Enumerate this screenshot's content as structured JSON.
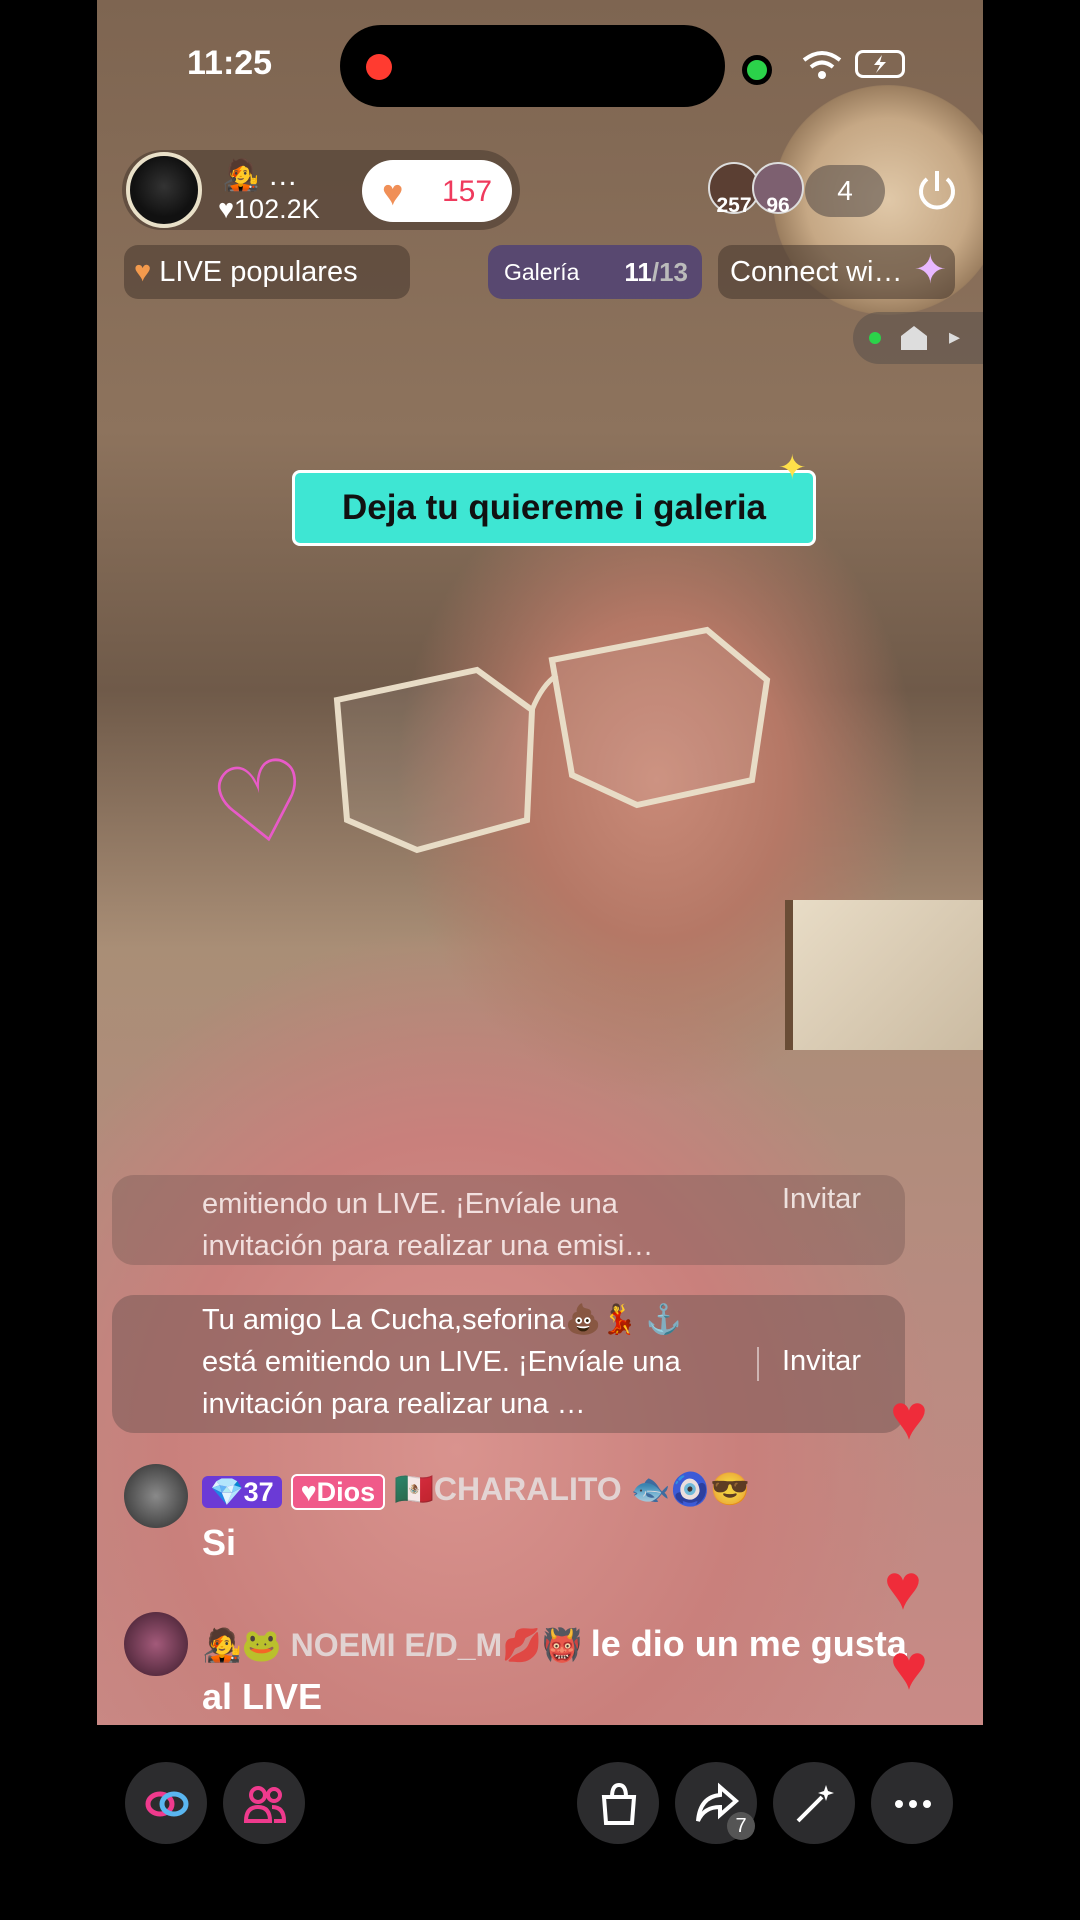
{
  "status": {
    "time": "11:25"
  },
  "host": {
    "name": "…",
    "likes": "102.2K",
    "like_count": "157"
  },
  "viewers": {
    "badge1": "257",
    "badge2": "96",
    "count": "4"
  },
  "tags": {
    "live_popular": "LIVE populares",
    "gallery_label": "Galería",
    "gallery_current": "11",
    "gallery_total": "/13",
    "connect": "Connect wi…"
  },
  "sticker": {
    "text": "Deja tu quiereme i galeria"
  },
  "invites": [
    {
      "text": "emitiendo un LIVE. ¡Envíale una invitación para realizar una emisi…",
      "button": "Invitar"
    },
    {
      "text": "Tu amigo La Cucha,seforina💩💃 ⚓ está emitiendo un LIVE. ¡Envíale una invitación para realizar una …",
      "button": "Invitar"
    }
  ],
  "comments": [
    {
      "level": "37",
      "fan_badge": "Dios",
      "name": "🇲🇽CHARALITO 🐟🧿😎",
      "text": "Si"
    },
    {
      "name": "🐸 NOEMI E/D_M💋👹",
      "text": "le dio un me gusta al LIVE"
    }
  ],
  "bottom": {
    "share_count": "7"
  },
  "colors": {
    "accent_pink": "#ef3a5d",
    "sticker": "#3ee6d3",
    "heart": "#ef2c3a",
    "gallery": "#483c78"
  }
}
